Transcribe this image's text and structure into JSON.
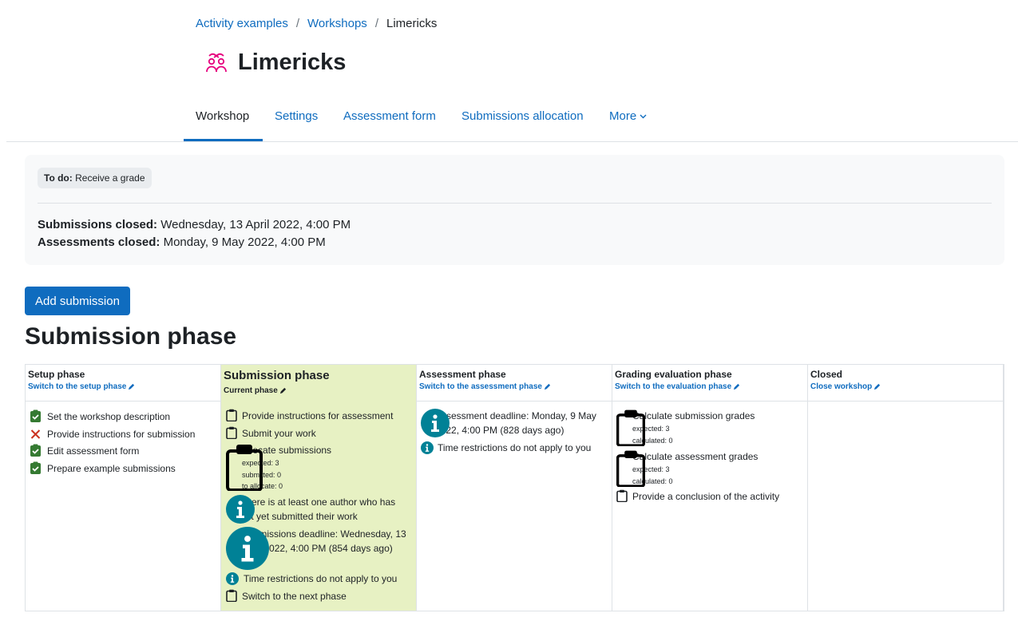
{
  "breadcrumb": {
    "item1": "Activity examples",
    "item2": "Workshops",
    "current": "Limericks",
    "separator": "/"
  },
  "page": {
    "title": "Limericks",
    "icon": "workshop-icon",
    "accent": "#e6007e"
  },
  "tabs": {
    "workshop": "Workshop",
    "settings": "Settings",
    "assessment_form": "Assessment form",
    "submissions_allocation": "Submissions allocation",
    "more": "More"
  },
  "todo": {
    "label": "To do:",
    "text": "Receive a grade"
  },
  "dates": {
    "submissions_label": "Submissions closed:",
    "submissions_value": "Wednesday, 13 April 2022, 4:00 PM",
    "assessments_label": "Assessments closed:",
    "assessments_value": "Monday, 9 May 2022, 4:00 PM"
  },
  "add_submission": "Add submission",
  "section_title": "Submission phase",
  "planner": {
    "setup": {
      "title": "Setup phase",
      "switch": "Switch to the setup phase",
      "tasks": [
        "Set the workshop description",
        "Provide instructions for submission",
        "Edit assessment form",
        "Prepare example submissions"
      ]
    },
    "submission": {
      "title": "Submission phase",
      "current": "Current phase",
      "tasks": {
        "t1": "Provide instructions for assessment",
        "t2": "Submit your work",
        "t3": "Allocate submissions",
        "t3_expected": "expected: 3",
        "t3_submitted": "submitted: 0",
        "t3_allocated": "to allocate: 0",
        "t4": "There is at least one author who has not yet submitted their work",
        "t5": "Submissions deadline: Wednesday, 13 April 2022, 4:00 PM (854 days ago)",
        "t6": "Time restrictions do not apply to you",
        "t7": "Switch to the next phase"
      }
    },
    "assessment": {
      "title": "Assessment phase",
      "switch": "Switch to the assessment phase",
      "tasks": {
        "t1": "Assessment deadline: Monday, 9 May 2022, 4:00 PM (828 days ago)",
        "t2": "Time restrictions do not apply to you"
      }
    },
    "evaluation": {
      "title": "Grading evaluation phase",
      "switch": "Switch to the evaluation phase",
      "tasks": {
        "t1": "Calculate submission grades",
        "t1_expected": "expected: 3",
        "t1_calculated": "calculated: 0",
        "t2": "Calculate assessment grades",
        "t2_expected": "expected: 3",
        "t2_calculated": "calculated: 0",
        "t3": "Provide a conclusion of the activity"
      }
    },
    "closed": {
      "title": "Closed",
      "switch": "Close workshop"
    }
  },
  "colors": {
    "link": "#0f6cbf",
    "success": "#357a32",
    "fail": "#ca3120",
    "info": "#008196",
    "current_phase_bg": "#e7f1c3"
  }
}
